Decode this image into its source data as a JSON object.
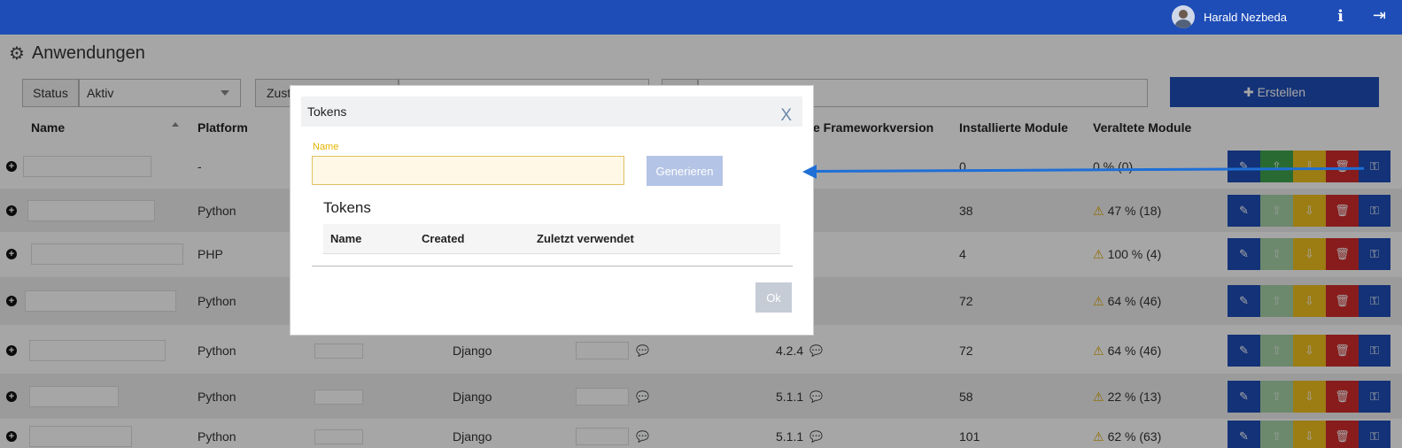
{
  "header": {
    "user_name": "Harald Nezbeda",
    "info_icon": "i",
    "logout_icon": "⇥"
  },
  "page": {
    "title": "Anwendungen"
  },
  "filters": {
    "status_label": "Status",
    "status_value": "Aktiv",
    "zu_label": "Zust",
    "create_button": "✚ Erstellen"
  },
  "table": {
    "columns": {
      "name": "Name",
      "platform": "Platform",
      "framework_version": "e Frameworkversion",
      "installed_modules": "Installierte Module",
      "outdated_modules": "Veraltete Module"
    },
    "rows": [
      {
        "platform": "-",
        "framework": "",
        "version": "",
        "installed": "0",
        "outdated": "0 % (0)",
        "warn": false
      },
      {
        "platform": "Python",
        "framework": "",
        "version": "",
        "installed": "38",
        "outdated": "47 % (18)",
        "warn": true
      },
      {
        "platform": "PHP",
        "framework": "",
        "version": "",
        "installed": "4",
        "outdated": "100 % (4)",
        "warn": true
      },
      {
        "platform": "Python",
        "framework": "",
        "version": "",
        "installed": "72",
        "outdated": "64 % (46)",
        "warn": true
      },
      {
        "platform": "Python",
        "framework": "Django",
        "version": "4.2.4",
        "installed": "72",
        "outdated": "64 % (46)",
        "warn": true
      },
      {
        "platform": "Python",
        "framework": "Django",
        "version": "5.1.1",
        "installed": "58",
        "outdated": "22 % (13)",
        "warn": true
      },
      {
        "platform": "Python",
        "framework": "Django",
        "version": "5.1.1",
        "installed": "101",
        "outdated": "62 % (63)",
        "warn": true
      }
    ]
  },
  "modal": {
    "title": "Tokens",
    "close": "X",
    "name_label": "Name",
    "name_value": "",
    "generate_button": "Generieren",
    "tokens_heading": "Tokens",
    "columns": {
      "name": "Name",
      "created": "Created",
      "last_used": "Zuletzt verwendet"
    },
    "ok_button": "Ok"
  },
  "colors": {
    "primary": "#1e4db7",
    "success": "#3fa34d",
    "warning": "#f0c020",
    "danger": "#d22b2b",
    "annotation_arrow": "#1f6fd6"
  }
}
